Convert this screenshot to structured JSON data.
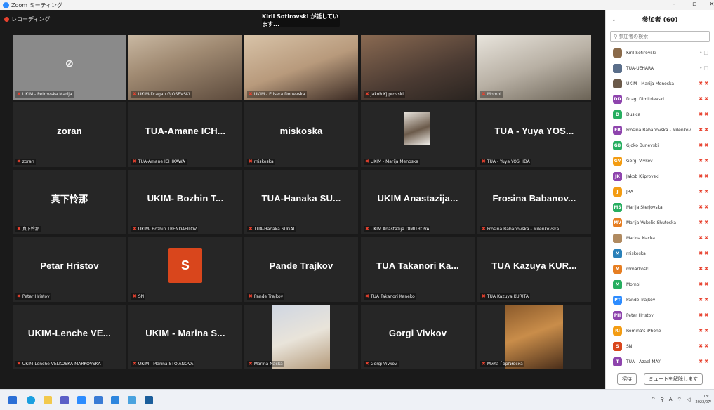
{
  "window": {
    "title": "Zoom ミーティング",
    "minimize": "–",
    "maximize": "▫",
    "close": "×"
  },
  "recording": {
    "label": "レコーディング"
  },
  "speaking": {
    "text": "Kiril Sotirovski が話しています..."
  },
  "tiles": [
    {
      "big": "",
      "label": "UKIM - Petrovska Marija",
      "kind": "camera-off"
    },
    {
      "big": "",
      "label": "UKIM-Dragan GJOSEVSKI",
      "kind": "video"
    },
    {
      "big": "",
      "label": "UKIM - Elisera Donevska",
      "kind": "video"
    },
    {
      "big": "",
      "label": "Jakob Kjiprovski",
      "kind": "video"
    },
    {
      "big": "",
      "label": "Momoi",
      "kind": "video"
    },
    {
      "big": "zoran",
      "label": "zoran"
    },
    {
      "big": "TUA-Amane ICH...",
      "label": "TUA-Amane ICHIKAWA"
    },
    {
      "big": "miskoska",
      "label": "miskoska"
    },
    {
      "big": "",
      "label": "UKIM - Marija Menoska",
      "kind": "thumb"
    },
    {
      "big": "TUA - Yuya YOS...",
      "label": "TUA - Yuya YOSHIDA"
    },
    {
      "big": "真下怜那",
      "label": "真下怜那"
    },
    {
      "big": "UKIM- Bozhin T...",
      "label": "UKIM- Bozhin TRENDAFILOV"
    },
    {
      "big": "TUA-Hanaka SU...",
      "label": "TUA-Hanaka SUGAI"
    },
    {
      "big": "UKIM Anastazija...",
      "label": "UKIM Anastazija DIMITROVA"
    },
    {
      "big": "Frosina Babanov...",
      "label": "Frosina Babanovska - Milenkovska"
    },
    {
      "big": "Petar Hristov",
      "label": "Petar Hristov"
    },
    {
      "big": "S",
      "label": "SN",
      "kind": "avatar"
    },
    {
      "big": "Pande Trajkov",
      "label": "Pande Trajkov"
    },
    {
      "big": "TUA Takanori Ka...",
      "label": "TUA Takanori Kaneko"
    },
    {
      "big": "TUA Kazuya KUR...",
      "label": "TUA Kazuya KURITA"
    },
    {
      "big": "UKIM-Lenche VE...",
      "label": "UKIM-Lenche VELKOSKA-MARKOVSKA"
    },
    {
      "big": "UKIM - Marina S...",
      "label": "UKIM - Marina STOJANOVA"
    },
    {
      "big": "",
      "label": "Marina Nacka",
      "kind": "video"
    },
    {
      "big": "Gorgi Vivkov",
      "label": "Gorgi Vivkov"
    },
    {
      "big": "",
      "label": "Мила Ѓорѓиеска",
      "kind": "video"
    }
  ],
  "panel": {
    "title": "参加者 (60)",
    "search_placeholder": "参加者の検索",
    "participants": [
      {
        "initials": "",
        "name": "Kiril Sotirovski",
        "color": "#8a6a4a",
        "muted": false
      },
      {
        "initials": "",
        "name": "TUA-UEHARA",
        "color": "#5a6e8a",
        "muted": false
      },
      {
        "initials": "",
        "name": "UKIM - Marija Menoska",
        "color": "#6b5a4a",
        "muted": true
      },
      {
        "initials": "DD",
        "name": "Dragi Dimitrievski",
        "color": "#8e44ad",
        "muted": true
      },
      {
        "initials": "D",
        "name": "Dusica",
        "color": "#27ae60",
        "muted": true
      },
      {
        "initials": "FB",
        "name": "Frosina Babanovska - Milenkov...",
        "color": "#8e44ad",
        "muted": true
      },
      {
        "initials": "GB",
        "name": "Gjoko Bunevski",
        "color": "#27ae60",
        "muted": true
      },
      {
        "initials": "GV",
        "name": "Gorgi Vivkov",
        "color": "#f39c12",
        "muted": true
      },
      {
        "initials": "JK",
        "name": "Jakob Kjiprovski",
        "color": "#8e44ad",
        "muted": true
      },
      {
        "initials": "J",
        "name": "JRA",
        "color": "#f39c12",
        "muted": true
      },
      {
        "initials": "MS",
        "name": "Marija Sterjovska",
        "color": "#27ae60",
        "muted": true
      },
      {
        "initials": "MV",
        "name": "Marija Vukelic-Shutoska",
        "color": "#e67e22",
        "muted": true
      },
      {
        "initials": "",
        "name": "Marina Nacka",
        "color": "#b08a60",
        "muted": true
      },
      {
        "initials": "M",
        "name": "miskoska",
        "color": "#2980b9",
        "muted": true
      },
      {
        "initials": "M",
        "name": "mmarkoski",
        "color": "#e67e22",
        "muted": true
      },
      {
        "initials": "M",
        "name": "Momoi",
        "color": "#27ae60",
        "muted": true
      },
      {
        "initials": "PT",
        "name": "Pande Trajkov",
        "color": "#2d8cff",
        "muted": true
      },
      {
        "initials": "PH",
        "name": "Petar Hristov",
        "color": "#8e44ad",
        "muted": true
      },
      {
        "initials": "RI",
        "name": "Romina's iPhone",
        "color": "#f39c12",
        "muted": true
      },
      {
        "initials": "S",
        "name": "SN",
        "color": "#d9461c",
        "muted": true
      },
      {
        "initials": "T",
        "name": "TUA - Azael MAY",
        "color": "#8e44ad",
        "muted": true
      }
    ],
    "invite_label": "招待",
    "unmute_label": "ミュートを解除します"
  },
  "taskbar": {
    "time": "18:1",
    "date": "2022/07/"
  }
}
